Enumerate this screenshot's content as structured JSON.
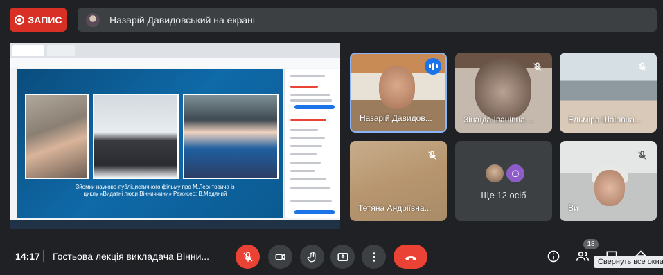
{
  "record": {
    "label": "ЗАПИС"
  },
  "presenting": {
    "text": "Назарій Давидовський на екрані"
  },
  "shared_screen": {
    "slide_caption": "Зйомки науково-публіцистичного фільму про М.Леонтовича із циклу «Видатні люди Вінниччини» Режисер: В.Медяний"
  },
  "participants": [
    {
      "name": "Назарій Давидов...",
      "mic": "speaking"
    },
    {
      "name": "Зінаїда Іванівна ...",
      "mic": "muted"
    },
    {
      "name": "Ельміра Шаігівна...",
      "mic": "muted"
    },
    {
      "name": "Тетяна Андріївна...",
      "mic": "muted"
    },
    {
      "name": "Ви",
      "mic": "muted"
    }
  ],
  "more_tile": {
    "avatar_letter": "О",
    "label": "Ще 12 осіб"
  },
  "bottom": {
    "time": "14:17",
    "meeting_title": "Гостьова лекція викладача Вінни...",
    "people_count": "18",
    "tooltip": "Свернуть все окна"
  },
  "colors": {
    "record": "#d93025",
    "end_call": "#ea4335",
    "active_speaker": "#8ab4f8",
    "speaking_indicator": "#1a73e8",
    "avatar_purple": "#8e5cc9"
  },
  "icons": [
    "record-dot-icon",
    "mic-off-icon",
    "camera-icon",
    "raise-hand-icon",
    "present-icon",
    "more-vert-icon",
    "end-call-icon",
    "info-icon",
    "people-icon",
    "chat-icon",
    "activities-icon",
    "speaking-icon"
  ]
}
